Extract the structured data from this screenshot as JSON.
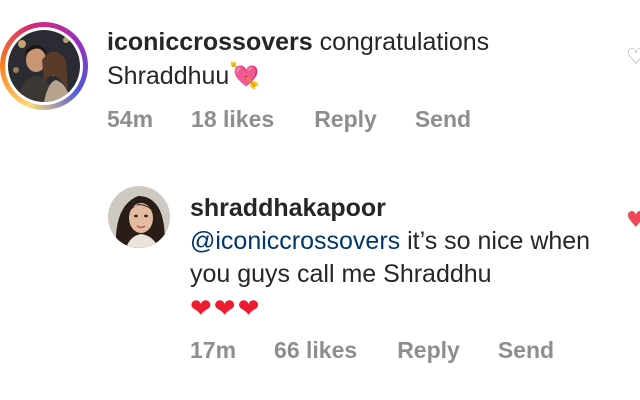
{
  "comments": [
    {
      "username": "iconiccrossovers",
      "text": "congratulations Shraddhuu",
      "emoji": "💘",
      "time": "54m",
      "likes": "18 likes",
      "reply_label": "Reply",
      "send_label": "Send",
      "liked": false
    },
    {
      "username": "shraddhakapoor",
      "mention": "@iconiccrossovers",
      "text": "it’s so nice when you guys call me Shraddhu",
      "hearts": "❤❤❤",
      "time": "17m",
      "likes": "66 likes",
      "reply_label": "Reply",
      "send_label": "Send",
      "liked": true
    }
  ],
  "icons": {
    "like_outline": "♡",
    "like_filled": "♥"
  },
  "colors": {
    "text": "#262626",
    "meta": "#8e8e8e",
    "mention": "#00376b",
    "heart": "#ed4956"
  }
}
